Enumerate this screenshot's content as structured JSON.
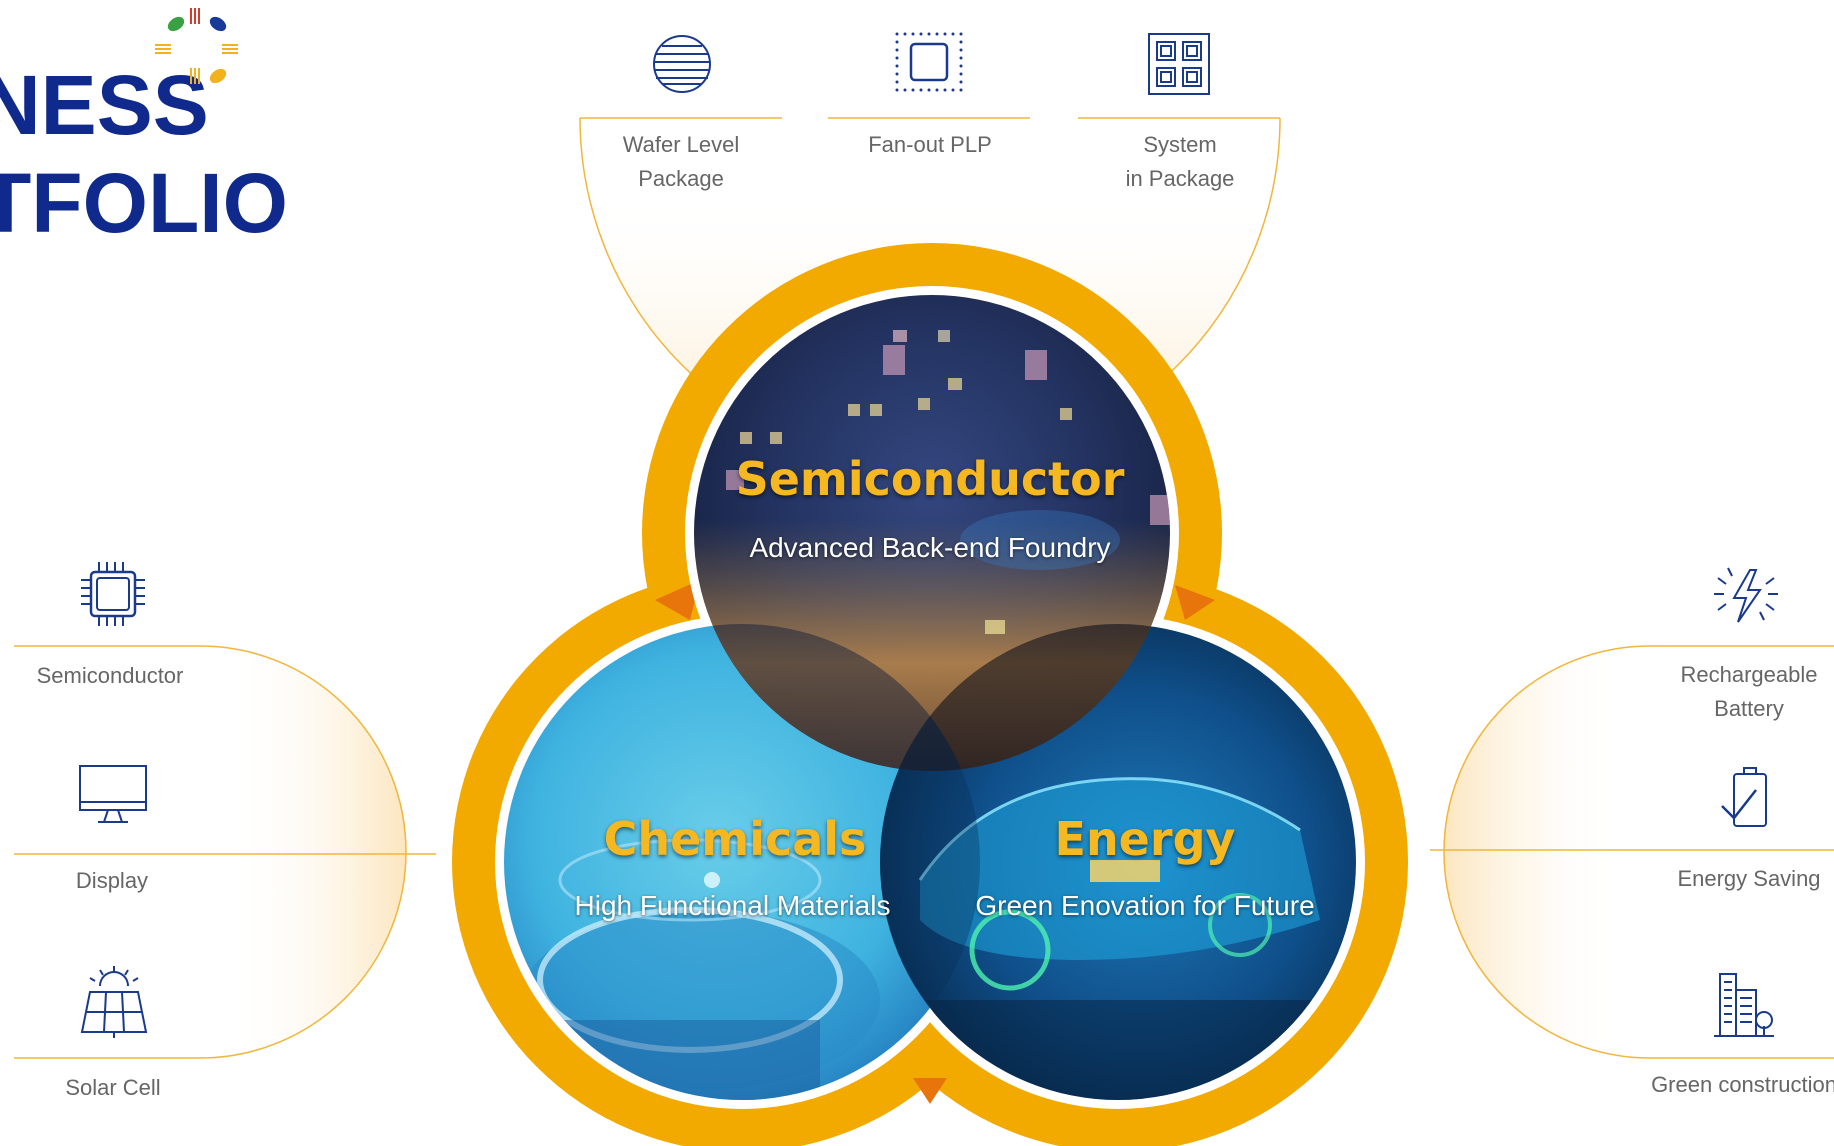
{
  "header": {
    "title_line1": "NESS",
    "title_line2": "TFOLIO"
  },
  "top_categories": [
    {
      "line1": "Wafer Level",
      "line2": "Package",
      "icon": "wafer-icon"
    },
    {
      "line1": "Fan-out PLP",
      "line2": "",
      "icon": "panel-chip-icon"
    },
    {
      "line1": "System",
      "line2": "in Package",
      "icon": "multi-chip-icon"
    }
  ],
  "left_categories": [
    {
      "label": "Semiconductor",
      "icon": "chip-icon"
    },
    {
      "label": "Display",
      "icon": "monitor-icon"
    },
    {
      "label": "Solar Cell",
      "icon": "solar-panel-icon"
    }
  ],
  "right_categories": [
    {
      "line1": "Rechargeable",
      "line2": "Battery",
      "icon": "lightning-icon"
    },
    {
      "line1": "Energy Saving",
      "line2": "",
      "icon": "battery-check-icon"
    },
    {
      "line1": "Green construction",
      "line2": "",
      "icon": "buildings-icon"
    }
  ],
  "circles": {
    "semiconductor": {
      "title": "Semiconductor",
      "subtitle": "Advanced Back-end Foundry"
    },
    "chemicals": {
      "title": "Chemicals",
      "subtitle": "High Functional Materials"
    },
    "energy": {
      "title": "Energy",
      "subtitle": "Green Enovation for Future"
    }
  },
  "colors": {
    "title_blue": "#0f2a8c",
    "ring_orange": "#f2a900",
    "ring_overlap": "#e8740c",
    "accent_yellow": "#f6b820",
    "line_yellow": "#f1b63c",
    "icon_blue": "#1a3a8c"
  }
}
